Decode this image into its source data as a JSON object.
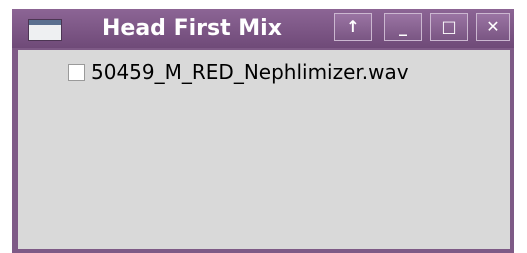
{
  "window": {
    "title": "Head First Mix",
    "buttons": {
      "up": "↑",
      "minimize": "_",
      "maximize": "□",
      "close": "✕"
    },
    "icons": {
      "app": "window-icon"
    }
  },
  "list": {
    "items": [
      {
        "label": "50459_M_RED_Nephlimizer.wav",
        "checked": false
      }
    ]
  },
  "colors": {
    "titlebar": "#7e5a86",
    "content_bg": "#d9d9d9"
  }
}
